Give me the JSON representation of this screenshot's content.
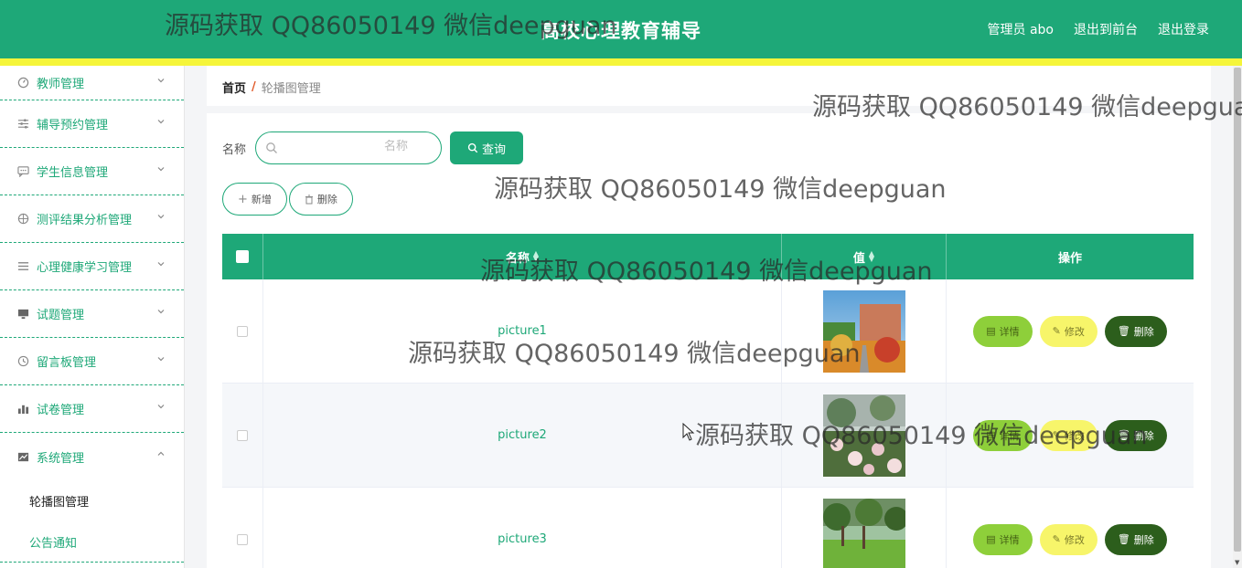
{
  "header": {
    "title": "高校心理教育辅导",
    "admin": "管理员 abo",
    "to_front": "退出到前台",
    "logout": "退出登录"
  },
  "sidebar": {
    "items": [
      {
        "label": "教师管理",
        "icon": "gauge-icon"
      },
      {
        "label": "辅导预约管理",
        "icon": "sliders-icon"
      },
      {
        "label": "学生信息管理",
        "icon": "chat-icon"
      },
      {
        "label": "测评结果分析管理",
        "icon": "compass-icon"
      },
      {
        "label": "心理健康学习管理",
        "icon": "list-icon"
      },
      {
        "label": "试题管理",
        "icon": "monitor-icon"
      },
      {
        "label": "留言板管理",
        "icon": "clock-icon"
      },
      {
        "label": "试卷管理",
        "icon": "bar-chart-icon"
      },
      {
        "label": "系统管理",
        "icon": "line-chart-icon"
      }
    ],
    "sub_items": [
      {
        "label": "轮播图管理"
      },
      {
        "label": "公告通知"
      }
    ]
  },
  "breadcrumb": {
    "home": "首页",
    "separator": "/",
    "current": "轮播图管理"
  },
  "search": {
    "label": "名称",
    "placeholder": "名称",
    "query_button": "查询"
  },
  "actions": {
    "add": "新增",
    "delete": "删除"
  },
  "table": {
    "columns": {
      "name": "名称",
      "value": "值",
      "operation": "操作"
    },
    "rows": [
      {
        "name": "picture1"
      },
      {
        "name": "picture2"
      },
      {
        "name": "picture3"
      }
    ],
    "row_actions": {
      "detail": "详情",
      "edit": "修改",
      "delete": "删除"
    }
  },
  "watermark": "源码获取 QQ86050149 微信deepguan",
  "colors": {
    "primary": "#1ea878",
    "accent_bar": "#f5f53a",
    "detail_button": "#8ecf3a",
    "edit_button": "#f7f56a",
    "delete_button": "#2c5e1c",
    "breadcrumb_separator": "#e05a2a"
  }
}
